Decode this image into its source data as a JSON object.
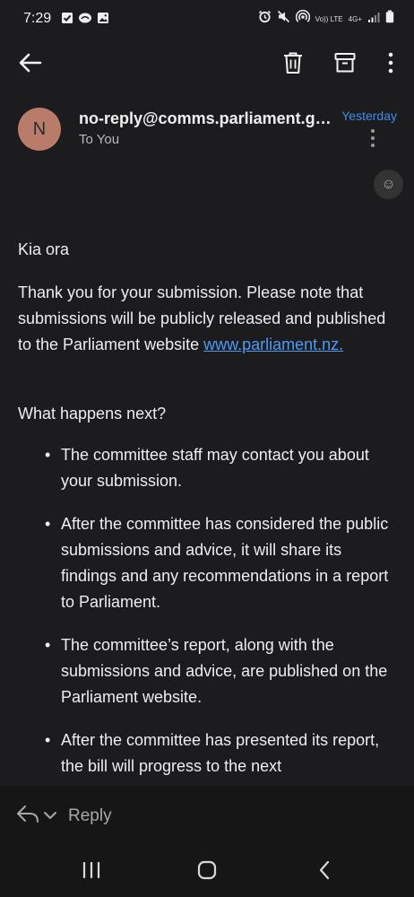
{
  "status_bar": {
    "time": "7:29",
    "left_icons": [
      "checkbox-icon",
      "cloud-icon",
      "image-icon"
    ],
    "right_icons": [
      "alarm-icon",
      "mute-icon",
      "hotspot-icon",
      "volte-icon",
      "network-4g-icon",
      "signal-icon",
      "battery-icon"
    ],
    "volte_text": "Vo)) LTE",
    "network_text": "4G+"
  },
  "toolbar": {
    "back_label": "Back",
    "delete_label": "Delete",
    "archive_label": "Archive",
    "more_label": "More options"
  },
  "email": {
    "avatar_initial": "N",
    "sender": "no-reply@comms.parliament.govt.nz",
    "recipient": "To You",
    "date": "Yesterday",
    "emoji_label": "☺",
    "greeting": "Kia ora",
    "paragraph1": "Thank you for your submission. Please note that submissions will be publicly released and published to the Parliament website ",
    "link": "www.parliament.nz.",
    "question": "What happens next?",
    "bullets": [
      "The committee staff may contact you about your submission.",
      "After the committee has considered the public submissions and advice, it will share its findings and any recommendations in a report to Parliament.",
      "The committee’s report, along with the submissions and advice, are published on the Parliament website.",
      "After the committee has presented its report, the bill will progress to the next"
    ]
  },
  "reply_bar": {
    "reply_label": "Reply"
  },
  "nav_bar": {
    "recents_label": "Recents",
    "home_label": "Home",
    "back_label": "Back"
  },
  "colors": {
    "background": "#1c1c1e",
    "avatar": "#b97c6b",
    "accent": "#3f8ee8",
    "link": "#4e9bf3"
  }
}
